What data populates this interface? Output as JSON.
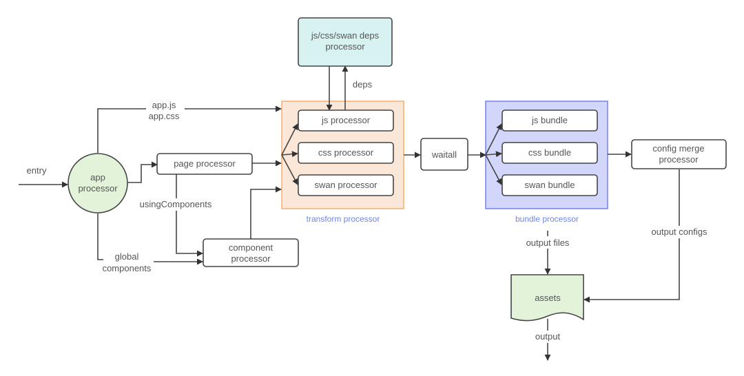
{
  "colors": {
    "app_fill": "#e2f3da",
    "deps_fill": "#d8f2f2",
    "transform_fill": "#fbe7d7",
    "transform_stroke": "#f4b27a",
    "transform_label": "#6f86e8",
    "bundle_fill": "#d2d6fb",
    "bundle_stroke": "#7b86ee",
    "bundle_label": "#6f86e8",
    "assets_fill": "#e2f3da",
    "stroke": "#444444",
    "text": "#555555"
  },
  "nodes": {
    "app": [
      "app",
      "processor"
    ],
    "page": [
      "page processor"
    ],
    "component": [
      "component",
      "processor"
    ],
    "deps": [
      "js/css/swan deps",
      "processor"
    ],
    "js_processor": [
      "js processor"
    ],
    "css_processor": [
      "css processor"
    ],
    "swan_processor": [
      "swan processor"
    ],
    "waitall": [
      "waitall"
    ],
    "js_bundle": [
      "js bundle"
    ],
    "css_bundle": [
      "css bundle"
    ],
    "swan_bundle": [
      "swan bundle"
    ],
    "config_merge": [
      "config merge",
      "processor"
    ],
    "assets": [
      "assets"
    ]
  },
  "groups": {
    "transform": "transform processor",
    "bundle": "bundle processor"
  },
  "edge_labels": {
    "entry": [
      "entry"
    ],
    "app_files": [
      "app.js",
      "app.css"
    ],
    "using_components": [
      "usingComponents"
    ],
    "global_components": [
      "global",
      "components"
    ],
    "deps": [
      "deps"
    ],
    "output_files": [
      "output files"
    ],
    "output_configs": [
      "output configs"
    ],
    "output": [
      "output"
    ]
  }
}
